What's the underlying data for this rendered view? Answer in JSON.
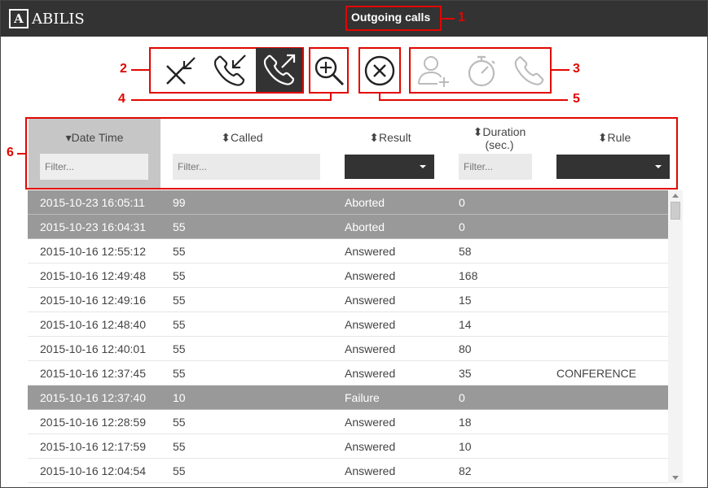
{
  "app": {
    "logo_text": "ABILIS",
    "logo_mark": "A",
    "title": "Outgoing calls"
  },
  "callouts": [
    "1",
    "2",
    "3",
    "4",
    "5",
    "6"
  ],
  "toolbar": {
    "group_filter": [
      {
        "name": "missed-calls-icon",
        "active": false
      },
      {
        "name": "incoming-calls-icon",
        "active": false
      },
      {
        "name": "outgoing-calls-icon",
        "active": true
      }
    ],
    "zoom": "zoom-in-icon",
    "clear": "clear-icon",
    "group_disabled": [
      "add-contact-icon",
      "timer-icon",
      "call-icon"
    ]
  },
  "table": {
    "columns": [
      {
        "label": "Date Time",
        "sort": "desc",
        "filter_placeholder": "Filter...",
        "type": "text"
      },
      {
        "label": "Called",
        "sort": "both",
        "filter_placeholder": "Filter...",
        "type": "text"
      },
      {
        "label": "Result",
        "sort": "both",
        "type": "select"
      },
      {
        "label": "Duration",
        "label2": "(sec.)",
        "sort": "both",
        "filter_placeholder": "Filter...",
        "type": "text"
      },
      {
        "label": "Rule",
        "sort": "both",
        "type": "select"
      }
    ],
    "rows": [
      {
        "datetime": "2015-10-23 16:05:11",
        "called": "99",
        "result": "Aborted",
        "duration": "0",
        "rule": "",
        "highlight": true
      },
      {
        "datetime": "2015-10-23 16:04:31",
        "called": "55",
        "result": "Aborted",
        "duration": "0",
        "rule": "",
        "highlight": true
      },
      {
        "datetime": "2015-10-16 12:55:12",
        "called": "55",
        "result": "Answered",
        "duration": "58",
        "rule": "",
        "highlight": false
      },
      {
        "datetime": "2015-10-16 12:49:48",
        "called": "55",
        "result": "Answered",
        "duration": "168",
        "rule": "",
        "highlight": false
      },
      {
        "datetime": "2015-10-16 12:49:16",
        "called": "55",
        "result": "Answered",
        "duration": "15",
        "rule": "",
        "highlight": false
      },
      {
        "datetime": "2015-10-16 12:48:40",
        "called": "55",
        "result": "Answered",
        "duration": "14",
        "rule": "",
        "highlight": false
      },
      {
        "datetime": "2015-10-16 12:40:01",
        "called": "55",
        "result": "Answered",
        "duration": "80",
        "rule": "",
        "highlight": false
      },
      {
        "datetime": "2015-10-16 12:37:45",
        "called": "55",
        "result": "Answered",
        "duration": "35",
        "rule": "CONFERENCE",
        "highlight": false
      },
      {
        "datetime": "2015-10-16 12:37:40",
        "called": "10",
        "result": "Failure",
        "duration": "0",
        "rule": "",
        "highlight": true
      },
      {
        "datetime": "2015-10-16 12:28:59",
        "called": "55",
        "result": "Answered",
        "duration": "18",
        "rule": "",
        "highlight": false
      },
      {
        "datetime": "2015-10-16 12:17:59",
        "called": "55",
        "result": "Answered",
        "duration": "10",
        "rule": "",
        "highlight": false
      },
      {
        "datetime": "2015-10-16 12:04:54",
        "called": "55",
        "result": "Answered",
        "duration": "82",
        "rule": "",
        "highlight": false
      }
    ]
  },
  "colors": {
    "topbar": "#333333",
    "accent": "#e10600",
    "row_highlight": "#999999",
    "active_button": "#333333",
    "disabled_icon": "#bbbbbb"
  }
}
